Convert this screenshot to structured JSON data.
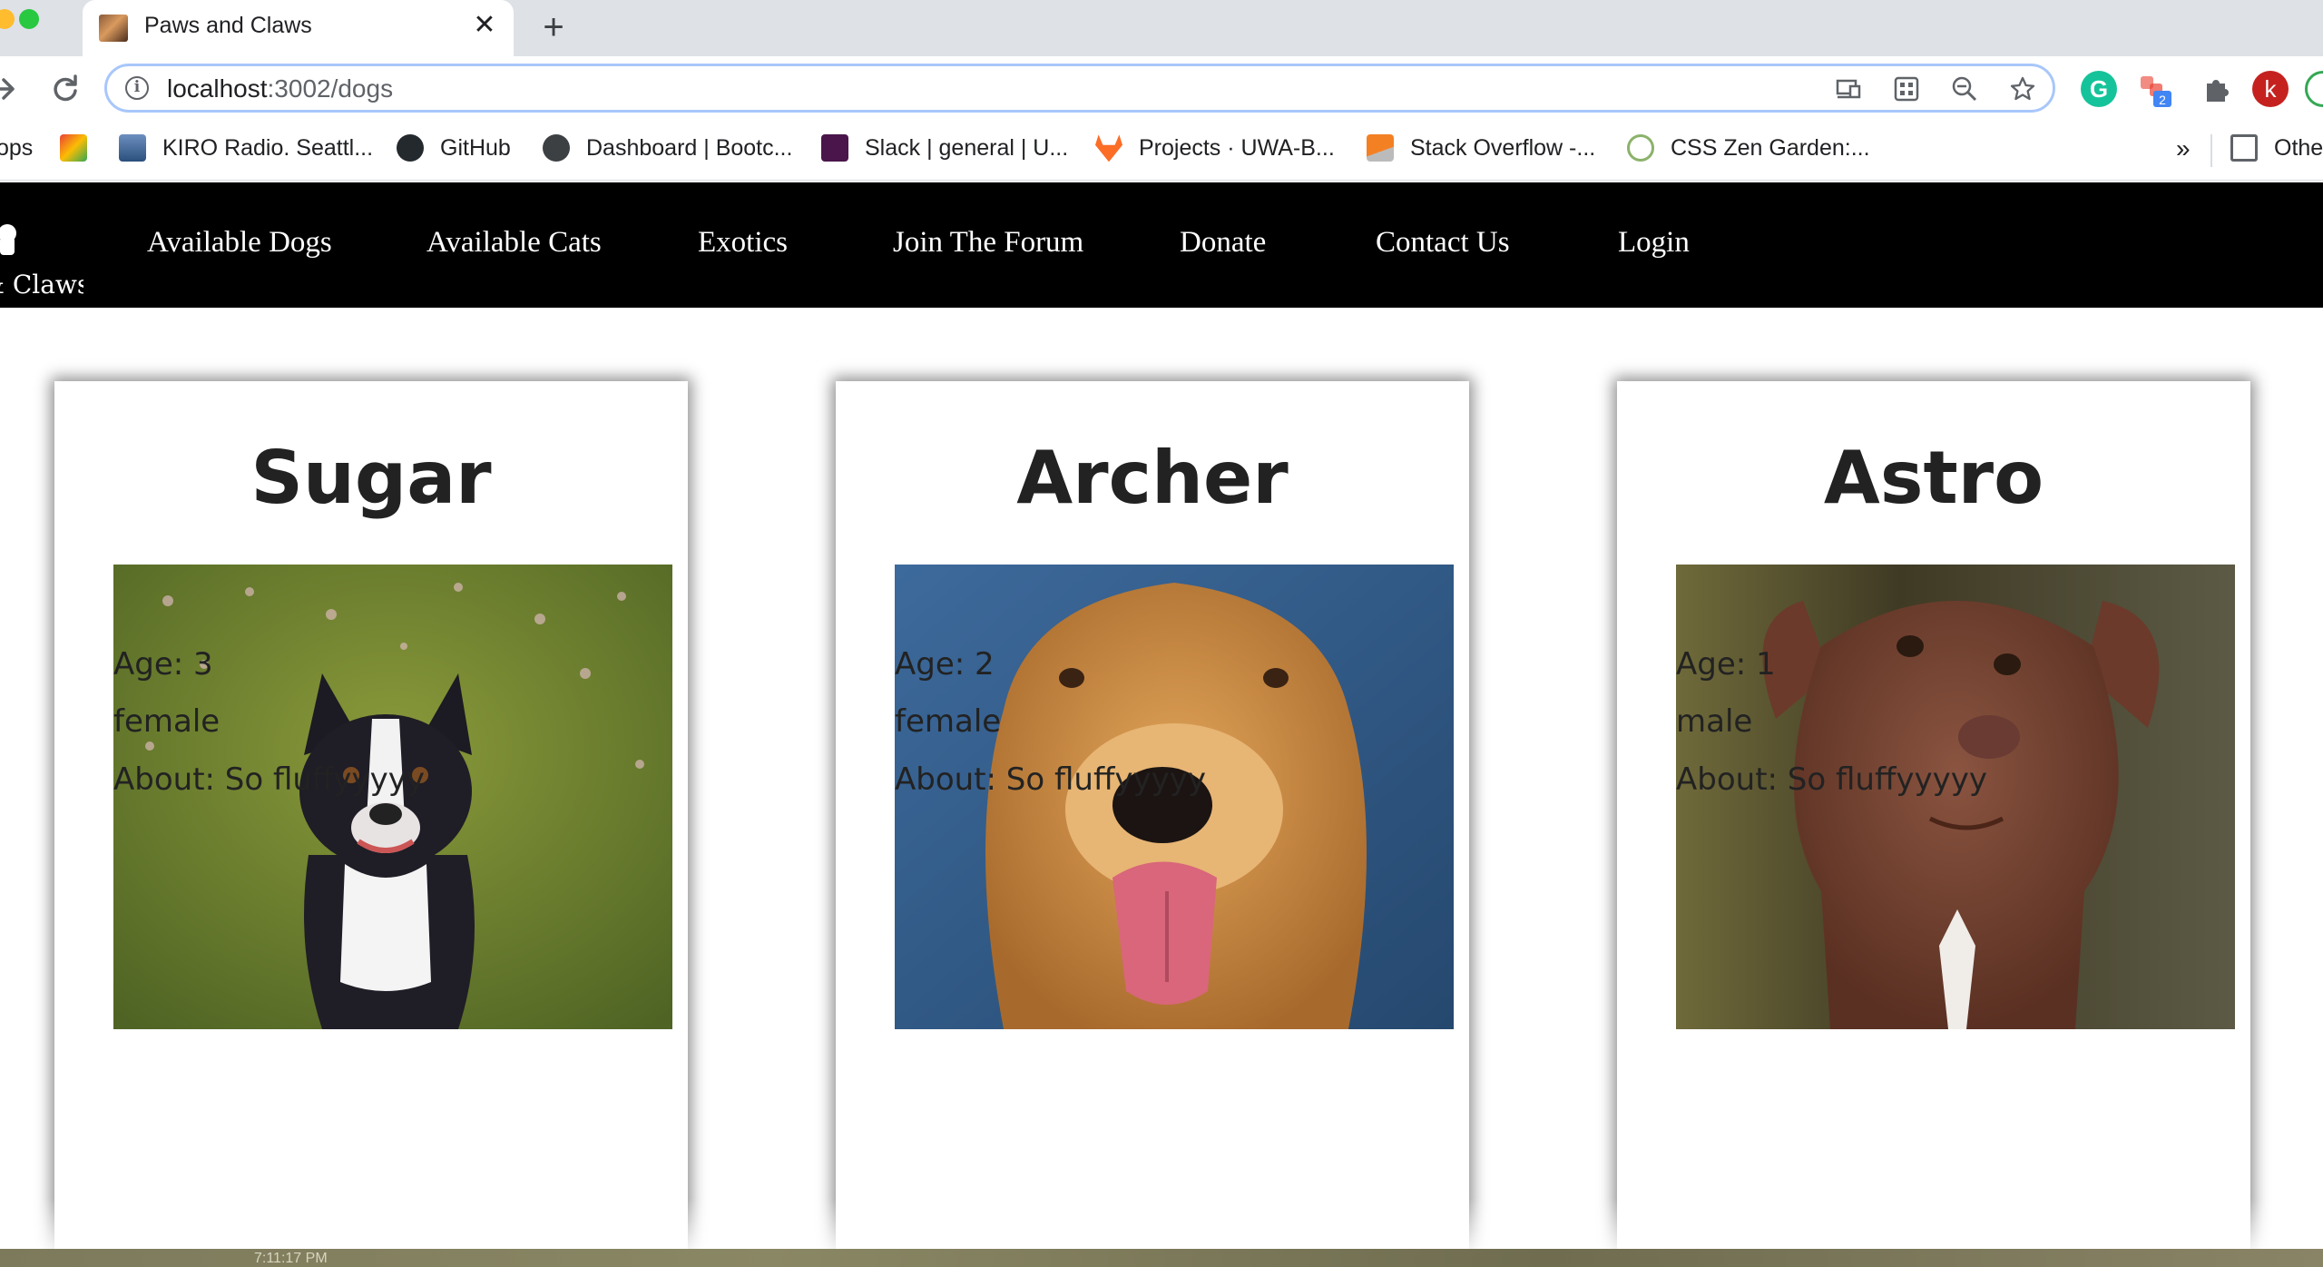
{
  "browser": {
    "tab_title": "Paws and Claws",
    "tab_close": "✕",
    "new_tab": "+",
    "url_host": "localhost",
    "url_path": ":3002/dogs",
    "profile_initial": "k",
    "extension_badge": "2",
    "bookmarks_more": "»",
    "bookmarks": [
      {
        "label": "ops",
        "icon": "apps-icon"
      },
      {
        "label": "",
        "icon": "google-photos-icon",
        "color": "#fbbc04"
      },
      {
        "label": "KIRO Radio. Seattl...",
        "icon": "kiro-icon",
        "color": "#3b6ea8"
      },
      {
        "label": "GitHub",
        "icon": "github-icon",
        "color": "#24292e"
      },
      {
        "label": "Dashboard | Bootc...",
        "icon": "globe-icon",
        "color": "#3c4043"
      },
      {
        "label": "Slack | general | U...",
        "icon": "slack-icon",
        "color": "#4a154b"
      },
      {
        "label": "Projects · UWA-B...",
        "icon": "gitlab-icon",
        "color": "#fc6d26"
      },
      {
        "label": "Stack Overflow -...",
        "icon": "stackoverflow-icon",
        "color": "#f48024"
      },
      {
        "label": "CSS Zen Garden:...",
        "icon": "zen-garden-icon",
        "color": "#8bb26a"
      }
    ],
    "other_bookmarks": "Othe"
  },
  "site": {
    "logo_text": "& Claws",
    "nav": [
      "Available Dogs",
      "Available Cats",
      "Exotics",
      "Join The Forum",
      "Donate",
      "Contact Us",
      "Login"
    ]
  },
  "dogs": [
    {
      "name": "Sugar",
      "age": "Age: 3",
      "sex": "female",
      "about": "About: So fluffyyyyy",
      "photo": "boston-terrier-photo"
    },
    {
      "name": "Archer",
      "age": "Age: 2",
      "sex": "female",
      "about": "About: So fluffyyyyy",
      "photo": "golden-retriever-photo"
    },
    {
      "name": "Astro",
      "age": "Age: 1",
      "sex": "male",
      "about": "About: So fluffyyyyy",
      "photo": "brown-pitbull-puppy-photo"
    }
  ],
  "desktop": {
    "clock": "7:11:17 PM"
  }
}
